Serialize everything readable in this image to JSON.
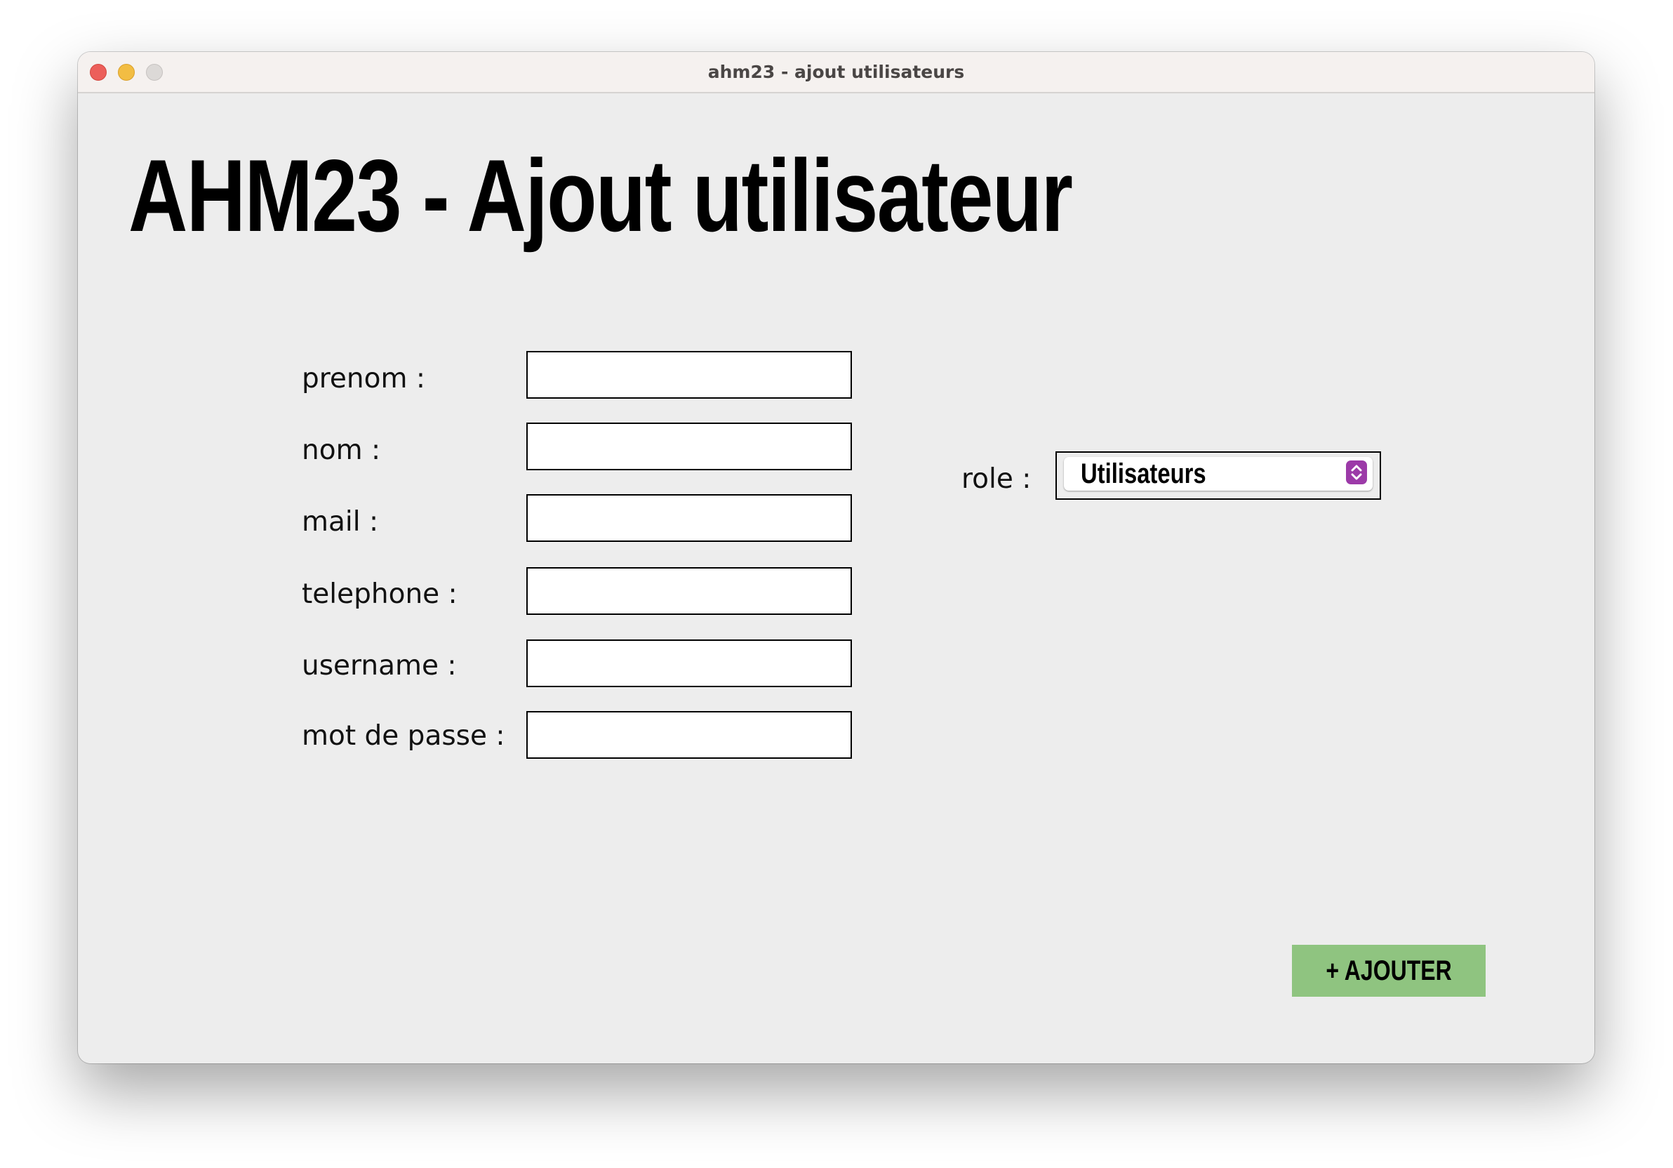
{
  "window": {
    "title": "ahm23 - ajout utilisateurs"
  },
  "page": {
    "title": "AHM23 - Ajout utilisateur"
  },
  "form": {
    "fields": [
      {
        "label": "prenom :",
        "value": ""
      },
      {
        "label": "nom :",
        "value": ""
      },
      {
        "label": "mail :",
        "value": ""
      },
      {
        "label": "telephone :",
        "value": ""
      },
      {
        "label": "username :",
        "value": ""
      },
      {
        "label": "mot de passe :",
        "value": ""
      }
    ],
    "role": {
      "label": "role :",
      "selected": "Utilisateurs"
    },
    "submit_label": "+ AJOUTER"
  },
  "colors": {
    "window_bg": "#ededed",
    "titlebar_bg": "#f5f1ef",
    "add_button": "#8fc480",
    "stepper_accent": "#9c3aa8",
    "close": "#ec5f5a",
    "minimize": "#f2bd43",
    "zoom": "#dcd9d7"
  },
  "icons": {
    "close": "close-icon",
    "minimize": "minimize-icon",
    "zoom": "zoom-icon",
    "stepper": "up-down-chevron-icon"
  }
}
